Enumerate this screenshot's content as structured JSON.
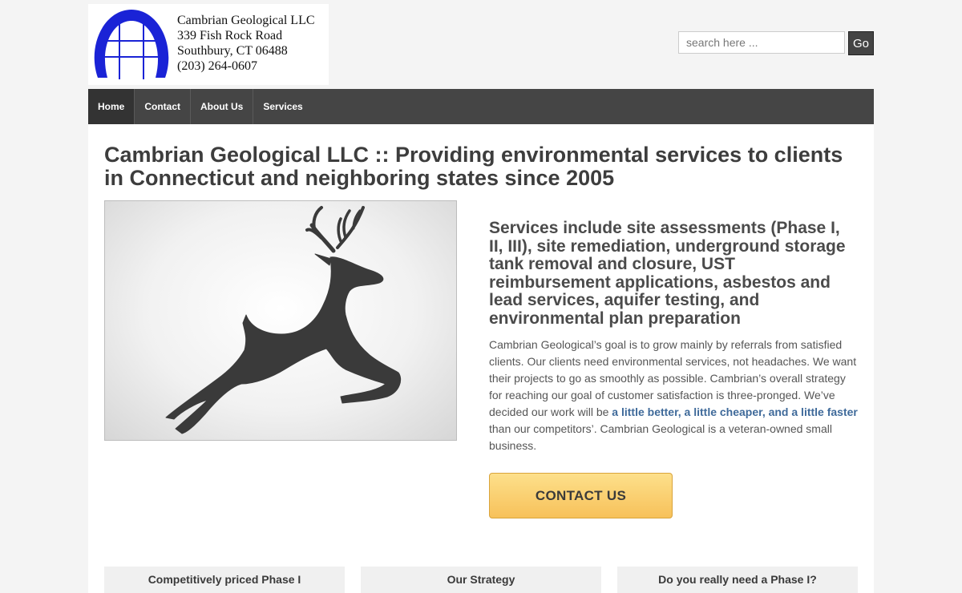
{
  "header": {
    "company": "Cambrian Geological LLC",
    "address_line1": "339 Fish Rock Road",
    "address_line2": "Southbury, CT 06488",
    "phone": "(203) 264-0607",
    "logo_icon": "dome-grid-logo",
    "logo_color": "#1a23d6"
  },
  "search": {
    "placeholder": "search here ...",
    "value": "",
    "button_label": "Go"
  },
  "nav": {
    "items": [
      {
        "label": "Home",
        "active": true
      },
      {
        "label": "Contact"
      },
      {
        "label": "About Us"
      },
      {
        "label": "Services"
      }
    ]
  },
  "main": {
    "title": "Cambrian Geological LLC :: Providing environmental services to clients in Connecticut and neighboring states since 2005",
    "hero_image": "leaping-deer-silhouette",
    "services_heading": "Services include site assessments (Phase I, II, III), site remediation, underground storage tank removal and closure, UST reimbursement applications, asbestos and lead services, aquifer testing, and environmental plan preparation",
    "intro_part1": "Cambrian Geological’s goal is to grow mainly by referrals from satisfied clients. Our clients need environmental services, not headaches. We want their projects to go as smoothly as possible. Cambrian’s overall strategy for reaching our goal of customer satisfaction is three-pronged. We’ve decided our work will be ",
    "intro_highlight": "a little better, a little cheaper, and a little faster",
    "intro_part2": " than our competitors’. Cambrian Geological is a veteran-owned small business.",
    "cta_label": "CONTACT US",
    "link_color": "#3f6a9a",
    "cta_color": "#f9cd6e"
  },
  "feature_boxes": [
    {
      "title": "Competitively priced Phase I"
    },
    {
      "title": "Our Strategy"
    },
    {
      "title": "Do you really need a Phase I?"
    }
  ]
}
